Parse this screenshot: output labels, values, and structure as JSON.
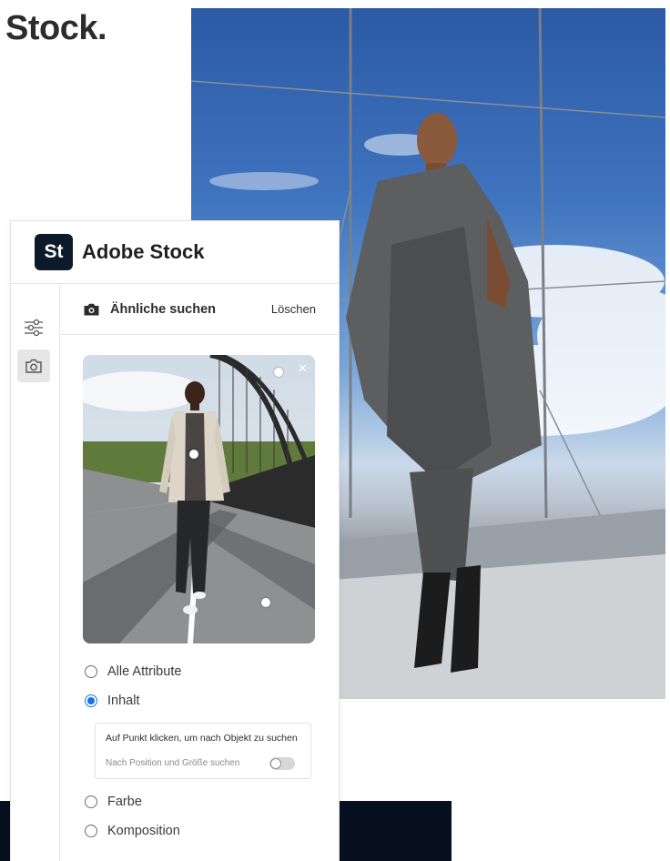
{
  "hero": {
    "heading": "Stock."
  },
  "panel": {
    "brand": {
      "logo_text": "St",
      "name": "Adobe Stock"
    },
    "rail": [
      {
        "icon": "filters-icon",
        "active": false
      },
      {
        "icon": "camera-icon",
        "active": true
      }
    ],
    "search": {
      "title": "Ähnliche suchen",
      "clear_label": "Löschen",
      "icon": "camera-icon"
    },
    "thumbnail": {
      "close_icon": "close-icon",
      "close_glyph": "✕"
    },
    "options": [
      {
        "label": "Alle Attribute",
        "checked": false
      },
      {
        "label": "Inhalt",
        "checked": true
      },
      {
        "label": "Farbe",
        "checked": false
      },
      {
        "label": "Komposition",
        "checked": false
      }
    ],
    "content_box": {
      "hint": "Auf Punkt klicken, um nach Objekt zu suchen",
      "toggle_label": "Nach Position und Größe suchen",
      "toggle_on": false
    }
  },
  "colors": {
    "accent": "#1473e6",
    "logo_bg": "#0d1a2b",
    "dark_band": "#06101f"
  }
}
